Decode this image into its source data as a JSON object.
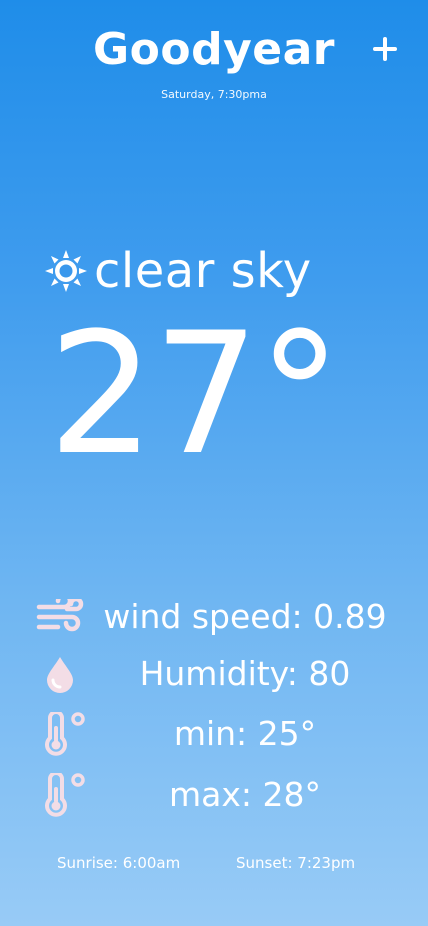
{
  "header": {
    "city": "Goodyear",
    "date": "Saturday, 7:30pma",
    "add_icon": "plus-icon"
  },
  "current": {
    "condition": "clear sky",
    "condition_icon": "sun-icon",
    "temperature": "27°"
  },
  "stats": [
    {
      "icon": "wind-icon",
      "label": "wind speed: 0.89"
    },
    {
      "icon": "humidity-drop-icon",
      "label": "Humidity: 80"
    },
    {
      "icon": "thermometer-icon",
      "label": "min: 25°"
    },
    {
      "icon": "thermometer-icon",
      "label": "max: 28°"
    }
  ],
  "footer": {
    "sunrise": "Sunrise: 6:00am",
    "sunset": "Sunset: 7:23pm"
  },
  "colors": {
    "background_top": "#1f8de9",
    "background_bottom": "#98cbf6",
    "text": "#ffffff",
    "icon_tint": "#f3dde6"
  }
}
